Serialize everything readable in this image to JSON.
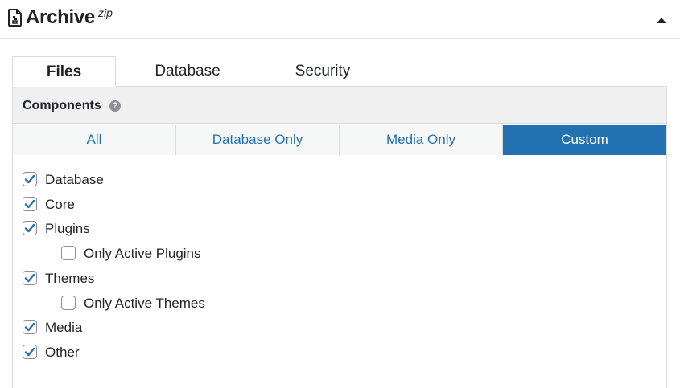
{
  "header": {
    "title": "Archive",
    "title_sup": "zip",
    "icon": "document-icon",
    "collapse_icon": "caret-up-icon"
  },
  "tabs": [
    {
      "label": "Files",
      "active": true
    },
    {
      "label": "Database",
      "active": false
    },
    {
      "label": "Security",
      "active": false
    }
  ],
  "components": {
    "title": "Components",
    "help_icon": "help-icon",
    "help_glyph": "?",
    "filters": [
      {
        "label": "All",
        "active": false
      },
      {
        "label": "Database Only",
        "active": false
      },
      {
        "label": "Media Only",
        "active": false
      },
      {
        "label": "Custom",
        "active": true
      }
    ],
    "items": [
      {
        "label": "Database",
        "checked": true
      },
      {
        "label": "Core",
        "checked": true
      },
      {
        "label": "Plugins",
        "checked": true
      },
      {
        "label": "Only Active Plugins",
        "checked": false
      },
      {
        "label": "Themes",
        "checked": true
      },
      {
        "label": "Only Active Themes",
        "checked": false
      },
      {
        "label": "Media",
        "checked": true
      },
      {
        "label": "Other",
        "checked": true
      }
    ]
  },
  "colors": {
    "accent": "#2271b1",
    "check": "#2271b1",
    "panel_header_bg": "#f0f0f1"
  }
}
